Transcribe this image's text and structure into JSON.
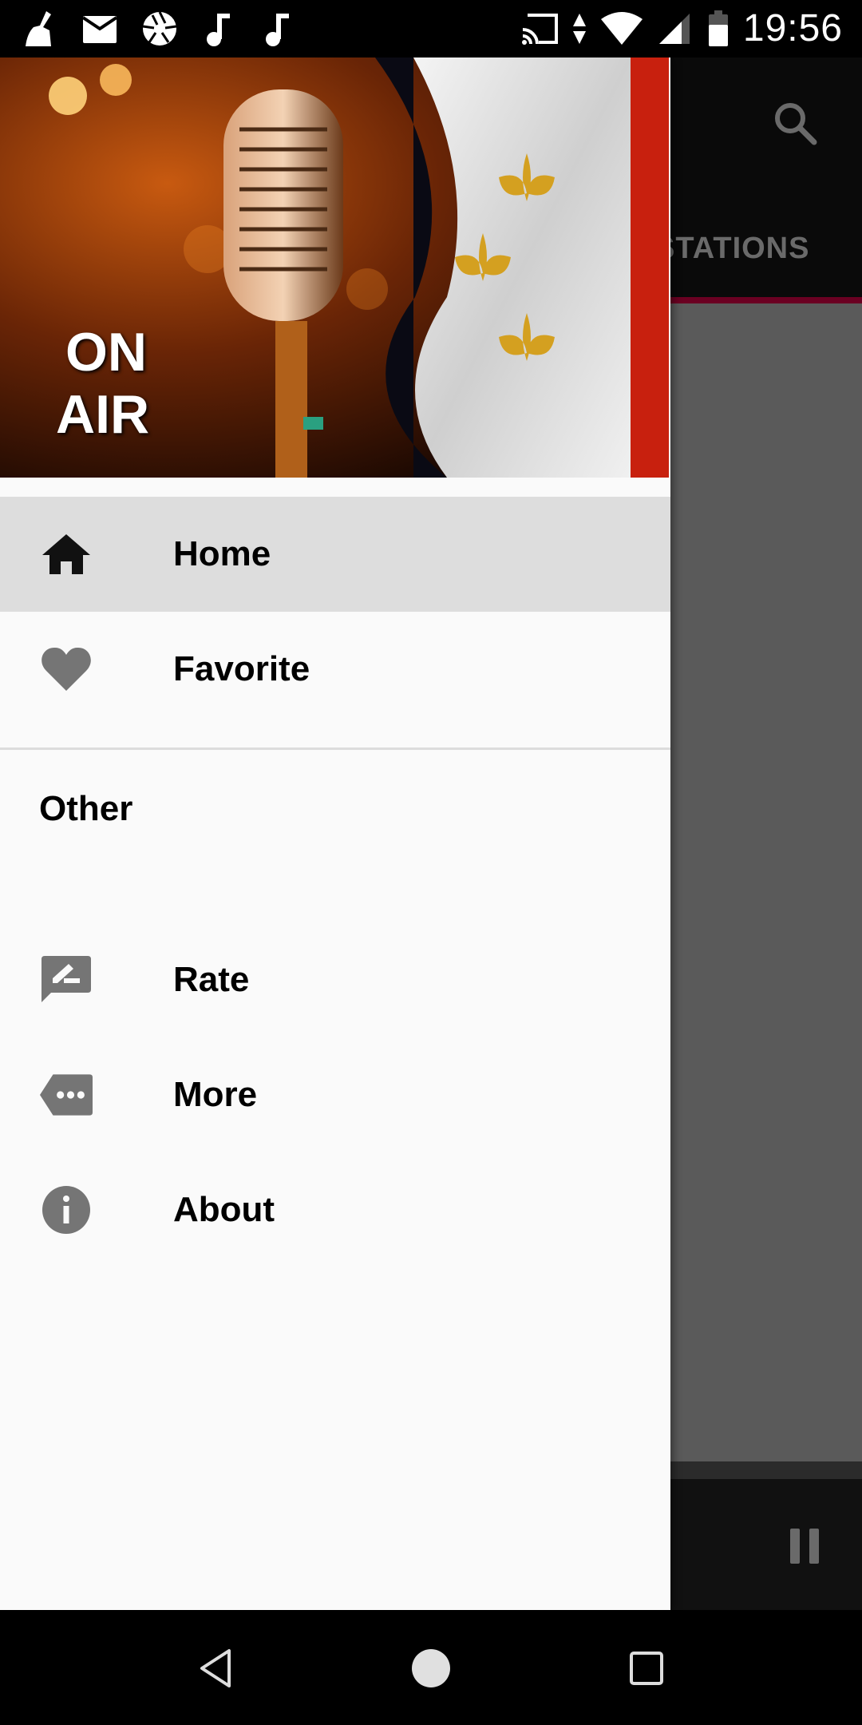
{
  "status_bar": {
    "time": "19:56",
    "left_icons": [
      "cleaner-icon",
      "mail-icon",
      "camera-aperture-icon",
      "music-note-icon",
      "music-note-icon"
    ],
    "right_icons": [
      "cast-icon",
      "data-arrows-icon",
      "wifi-icon",
      "cell-signal-icon",
      "battery-icon"
    ]
  },
  "background_app": {
    "search_icon": "search-icon",
    "visible_tab": "STATIONS",
    "toolbar_color": "#0a0a0a",
    "tab_indicator_color": "#6b0022",
    "player_control": "pause-icon"
  },
  "drawer": {
    "header": {
      "overlay_text_line1": "ON",
      "overlay_text_line2": "AIR"
    },
    "primary_items": [
      {
        "label": "Home",
        "icon": "home-icon",
        "active": true
      },
      {
        "label": "Favorite",
        "icon": "heart-icon",
        "active": false
      }
    ],
    "section_title": "Other",
    "secondary_items": [
      {
        "label": "Rate",
        "icon": "rate-review-icon"
      },
      {
        "label": "More",
        "icon": "more-tag-icon"
      },
      {
        "label": "About",
        "icon": "info-icon"
      }
    ],
    "active_bg": "#dddddd",
    "bg": "#fafafa"
  },
  "nav_bar": {
    "buttons": [
      "back-icon",
      "home-circle-icon",
      "recents-icon"
    ]
  }
}
